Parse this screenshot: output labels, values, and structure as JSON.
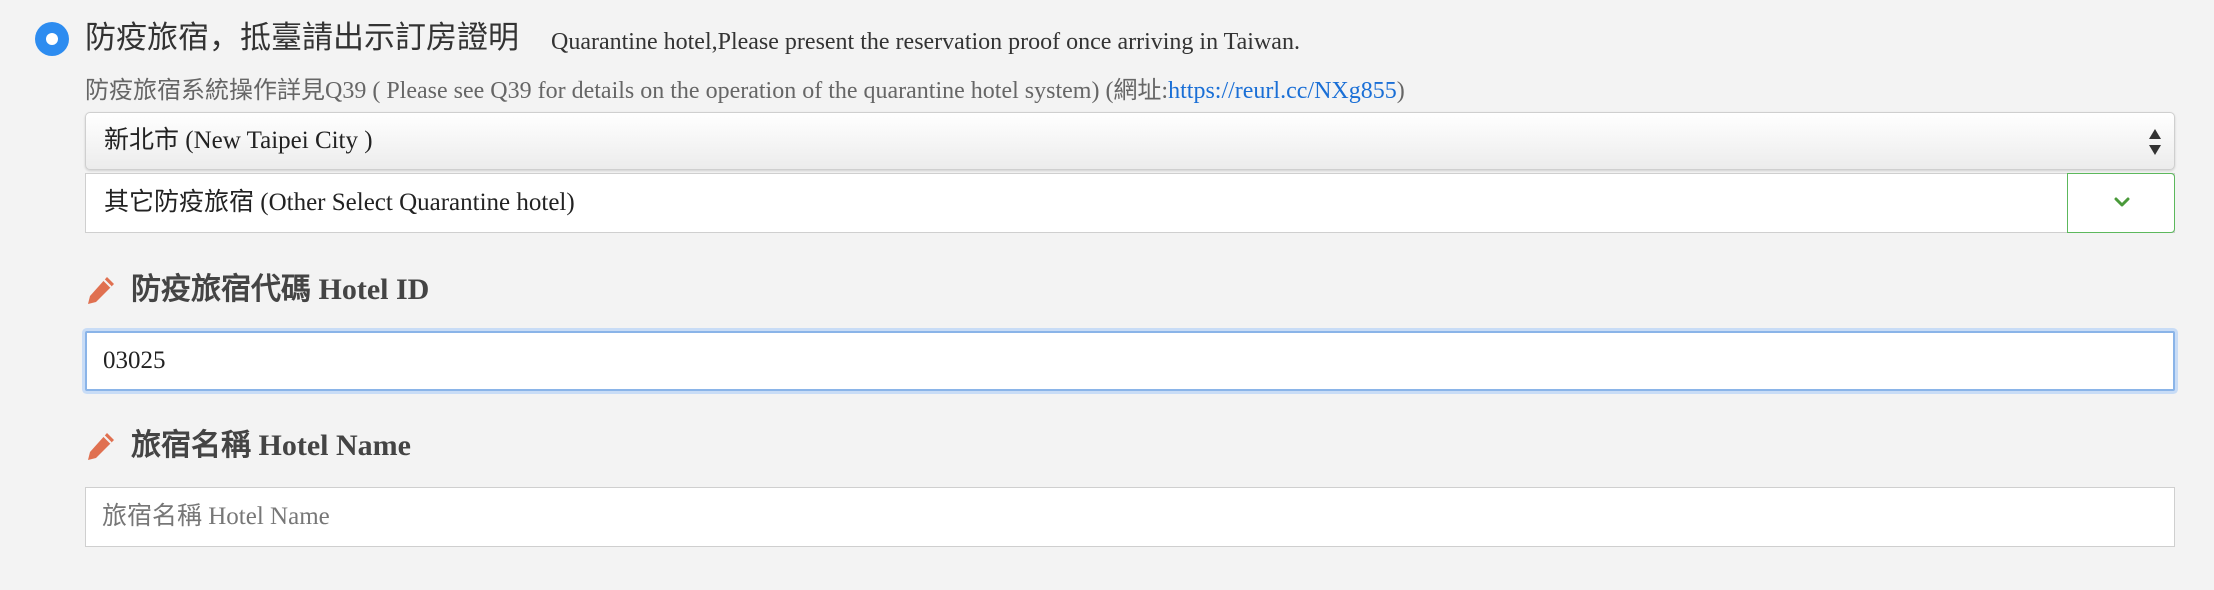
{
  "quarantine_option": {
    "title": "防疫旅宿，抵臺請出示訂房證明",
    "subtitle": "Quarantine hotel,Please present the reservation proof once arriving in Taiwan.",
    "selected": true
  },
  "hint": {
    "text": "防疫旅宿系統操作詳見Q39 ( Please see Q39 for details on the operation of the quarantine hotel system) (網址:",
    "link_text": "https://reurl.cc/NXg855",
    "suffix": ")"
  },
  "city_select": {
    "value": "新北市 (New Taipei City )"
  },
  "hotel_select": {
    "value": "其它防疫旅宿 (Other Select Quarantine hotel)"
  },
  "hotel_id": {
    "label": "防疫旅宿代碼 Hotel ID",
    "value": "03025"
  },
  "hotel_name": {
    "label": "旅宿名稱 Hotel Name",
    "placeholder": "旅宿名稱 Hotel Name",
    "value": ""
  },
  "colors": {
    "radio": "#2d8cf0",
    "pencil": "#e07050",
    "dropdown_border": "#5cb85c",
    "link": "#1a6fd6"
  },
  "icons": [
    "radio-selected-icon",
    "select-arrows-icon",
    "chevron-down-icon",
    "pencil-icon"
  ]
}
